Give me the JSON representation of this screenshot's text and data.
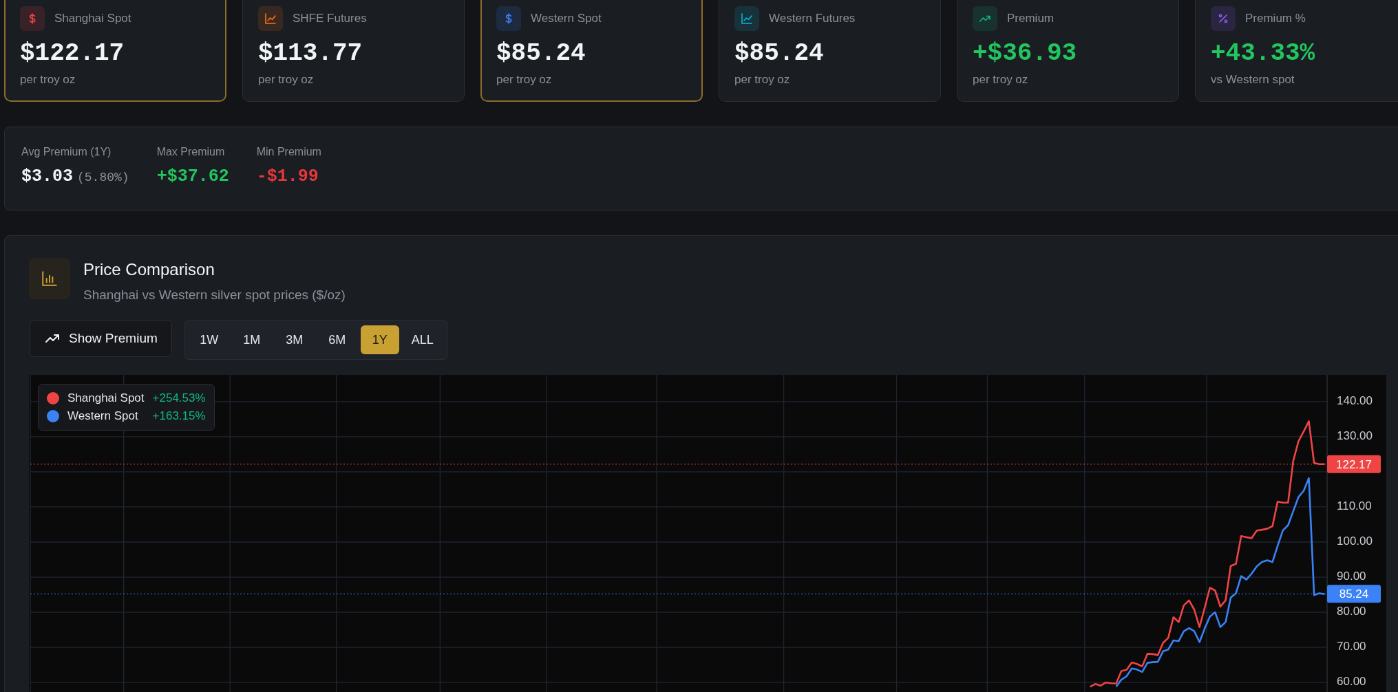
{
  "price_cards": [
    {
      "label": "Shanghai Spot",
      "value": "$122.17",
      "sub": "per troy oz",
      "color": "#ef4444",
      "highlighted": true,
      "kind": "plain"
    },
    {
      "label": "SHFE Futures",
      "value": "$113.77",
      "sub": "per troy oz",
      "color": "#f97316",
      "highlighted": false,
      "kind": "plain"
    },
    {
      "label": "Western Spot",
      "value": "$85.24",
      "sub": "per troy oz",
      "color": "#3b82f6",
      "highlighted": true,
      "kind": "plain"
    },
    {
      "label": "Western Futures",
      "value": "$85.24",
      "sub": "per troy oz",
      "color": "#06b6d4",
      "highlighted": false,
      "kind": "plain"
    },
    {
      "label": "Premium",
      "value": "+$36.93",
      "sub": "per troy oz",
      "color": "#10b981",
      "highlighted": false,
      "kind": "gain"
    },
    {
      "label": "Premium %",
      "value": "+43.33%",
      "sub": "vs Western spot",
      "color": "#8b5cf6",
      "highlighted": false,
      "kind": "gain"
    }
  ],
  "premium_stats": [
    {
      "label": "Avg Premium (1Y)",
      "value": "$3.03",
      "note": "(5.80%)",
      "kind": "plain"
    },
    {
      "label": "Max Premium",
      "value": "+$37.62",
      "kind": "gain"
    },
    {
      "label": "Min Premium",
      "value": "-$1.99",
      "kind": "loss"
    }
  ],
  "price_comparison": {
    "title": "Price Comparison",
    "subtitle": "Shanghai vs Western silver spot prices ($/oz)",
    "toggle_button": "Show Premium",
    "ranges": [
      {
        "label": "1W",
        "selected": false
      },
      {
        "label": "1M",
        "selected": false
      },
      {
        "label": "3M",
        "selected": false
      },
      {
        "label": "6M",
        "selected": false
      },
      {
        "label": "1Y",
        "selected": true
      },
      {
        "label": "ALL",
        "selected": false
      }
    ],
    "legend_items": [
      {
        "change": "+254.53%"
      },
      {
        "change": "+163.15%"
      }
    ],
    "chart_data": {
      "type": "line",
      "ylim": [
        57.3,
        147.6
      ],
      "grid": true,
      "legend": true,
      "yticks": [
        {
          "value": 60,
          "label": "60.00"
        },
        {
          "value": 70,
          "label": "70.00"
        },
        {
          "value": 80,
          "label": "80.00"
        },
        {
          "value": 90,
          "label": "90.00"
        },
        {
          "value": 100,
          "label": "100.00"
        },
        {
          "value": 110,
          "label": "110.00"
        },
        {
          "value": 130,
          "label": "130.00"
        },
        {
          "value": 140,
          "label": "140.00"
        }
      ],
      "series": [
        {
          "name": "Shanghai Spot",
          "color": "#ef4444",
          "values": [
            null,
            null,
            null,
            null,
            null,
            null,
            null,
            null,
            null,
            null,
            null,
            null,
            null,
            null,
            null,
            null,
            null,
            null,
            null,
            null,
            null,
            null,
            null,
            null,
            null,
            null,
            null,
            null,
            null,
            null,
            null,
            null,
            null,
            null,
            null,
            null,
            null,
            null,
            null,
            null,
            null,
            null,
            null,
            null,
            null,
            null,
            null,
            null,
            null,
            null,
            null,
            null,
            null,
            null,
            null,
            null,
            null,
            null,
            null,
            null,
            null,
            null,
            null,
            null,
            null,
            null,
            null,
            null,
            null,
            null,
            null,
            null,
            null,
            null,
            null,
            null,
            null,
            null,
            null,
            null,
            null,
            null,
            null,
            null,
            null,
            null,
            null,
            null,
            null,
            null,
            null,
            null,
            null,
            null,
            null,
            null,
            null,
            null,
            null,
            null,
            null,
            null,
            null,
            null,
            null,
            null,
            null,
            null,
            null,
            null,
            null,
            null,
            null,
            null,
            null,
            null,
            null,
            null,
            null,
            null,
            null,
            null,
            null,
            null,
            null,
            null,
            null,
            null,
            null,
            null,
            null,
            null,
            null,
            null,
            null,
            null,
            null,
            null,
            null,
            null,
            null,
            null,
            null,
            null,
            null,
            null,
            null,
            null,
            null,
            null,
            null,
            null,
            null,
            null,
            null,
            null,
            null,
            null,
            null,
            null,
            null,
            null,
            null,
            null,
            null,
            null,
            null,
            null,
            null,
            null,
            null,
            null,
            null,
            null,
            null,
            null,
            null,
            null,
            null,
            null,
            null,
            null,
            null,
            null,
            null,
            null,
            null,
            null,
            null,
            null,
            null,
            null,
            null,
            null,
            null,
            null,
            null,
            null,
            null,
            null,
            null,
            null,
            null,
            58.8,
            59.6,
            59.1,
            60.0,
            59.8,
            59.7,
            63.3,
            63.6,
            65.7,
            65.3,
            64.6,
            68.2,
            68.1,
            67.8,
            71.3,
            72.7,
            78.6,
            77.2,
            82.0,
            83.4,
            80.7,
            75.8,
            81.3,
            87.0,
            86.2,
            81.6,
            83.4,
            93.2,
            93.8,
            101.7,
            101.4,
            101.1,
            103.3,
            103.5,
            103.8,
            104.5,
            111.5,
            111.2,
            111.2,
            123.1,
            128.7,
            131.5,
            134.4,
            122.5,
            122.2,
            122.2
          ]
        },
        {
          "name": "Western Spot",
          "color": "#3b82f6",
          "values": [
            null,
            null,
            null,
            null,
            null,
            null,
            null,
            null,
            null,
            null,
            null,
            null,
            null,
            null,
            null,
            null,
            null,
            null,
            null,
            null,
            null,
            null,
            null,
            null,
            null,
            null,
            null,
            null,
            null,
            null,
            null,
            null,
            null,
            null,
            null,
            null,
            null,
            null,
            null,
            null,
            null,
            null,
            null,
            null,
            null,
            null,
            null,
            null,
            null,
            null,
            null,
            null,
            null,
            null,
            null,
            null,
            null,
            null,
            null,
            null,
            null,
            null,
            null,
            null,
            null,
            null,
            null,
            null,
            null,
            null,
            null,
            null,
            null,
            null,
            null,
            null,
            null,
            null,
            null,
            null,
            null,
            null,
            null,
            null,
            null,
            null,
            null,
            null,
            null,
            null,
            null,
            null,
            null,
            null,
            null,
            null,
            null,
            null,
            null,
            null,
            null,
            null,
            null,
            null,
            null,
            null,
            null,
            null,
            null,
            null,
            null,
            null,
            null,
            null,
            null,
            null,
            null,
            null,
            null,
            null,
            null,
            null,
            null,
            null,
            null,
            null,
            null,
            null,
            null,
            null,
            null,
            null,
            null,
            null,
            null,
            null,
            null,
            null,
            null,
            null,
            null,
            null,
            null,
            null,
            null,
            null,
            null,
            null,
            null,
            null,
            null,
            null,
            null,
            null,
            null,
            null,
            null,
            null,
            null,
            null,
            null,
            null,
            null,
            null,
            null,
            null,
            null,
            null,
            null,
            null,
            null,
            null,
            null,
            null,
            null,
            null,
            null,
            null,
            null,
            null,
            null,
            null,
            null,
            null,
            null,
            null,
            null,
            null,
            null,
            null,
            null,
            null,
            null,
            null,
            null,
            null,
            null,
            null,
            null,
            null,
            null,
            null,
            null,
            null,
            null,
            null,
            null,
            null,
            58.8,
            60.8,
            61.8,
            64.0,
            63.7,
            63.0,
            65.6,
            65.8,
            65.9,
            68.9,
            69.4,
            72.0,
            71.8,
            74.6,
            75.5,
            74.6,
            71.5,
            75.4,
            78.8,
            80.0,
            75.8,
            77.2,
            84.2,
            85.4,
            90.3,
            89.3,
            91.0,
            93.1,
            94.3,
            94.8,
            94.3,
            98.9,
            103.3,
            104.8,
            108.8,
            112.8,
            114.6,
            118.2,
            84.9,
            85.4,
            85.2
          ]
        }
      ],
      "ref_lines": [
        {
          "axis": "y",
          "value": 122.17,
          "label": "122.17",
          "color": "#ef4444"
        },
        {
          "axis": "y",
          "value": 85.24,
          "label": "85.24",
          "color": "#3b82f6"
        }
      ]
    }
  }
}
